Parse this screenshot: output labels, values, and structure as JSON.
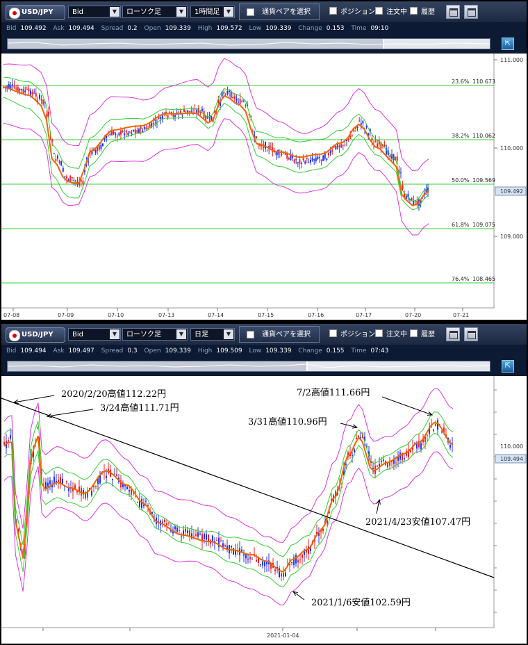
{
  "top_panel": {
    "pair_label": "USD/JPY",
    "price_type": "Bid",
    "chart_type": "ローソク足",
    "timeframe": "1時間足",
    "select_pair_label": "通貨ペアを選択",
    "checkbox_position": "ポジション",
    "checkbox_orders": "注文中",
    "checkbox_history": "履歴",
    "quote": {
      "bid": "109.492",
      "ask": "109.494",
      "spread": "0.2",
      "open": "109.339",
      "high": "109.572",
      "low": "109.339",
      "change": "0.153",
      "time": "09:10"
    },
    "price_labels": [
      "111.000",
      "110.000",
      "109.000"
    ],
    "current_price": "109.492",
    "date_labels": [
      "07-08",
      "07-09",
      "07-10",
      "07-13",
      "07-14",
      "07-15",
      "07-16",
      "07-17",
      "07-20",
      "07-21"
    ],
    "fibonacci": [
      {
        "pct": "23.6%",
        "price": "110.673"
      },
      {
        "pct": "38.2%",
        "price": "110.062"
      },
      {
        "pct": "50.0%",
        "price": "109.569"
      },
      {
        "pct": "61.8%",
        "price": "109.075"
      },
      {
        "pct": "76.4%",
        "price": "108.465"
      }
    ]
  },
  "bottom_panel": {
    "pair_label": "USD/JPY",
    "price_type": "Bid",
    "chart_type": "ローソク足",
    "timeframe": "日足",
    "select_pair_label": "通貨ペアを選択",
    "checkbox_position": "ポジション",
    "checkbox_orders": "注文中",
    "checkbox_history": "履歴",
    "quote": {
      "bid": "109.494",
      "ask": "109.497",
      "spread": "0.3",
      "open": "109.339",
      "high": "109.509",
      "low": "109.339",
      "change": "0.155",
      "time": "07:43"
    },
    "price_labels": [
      "110.000"
    ],
    "current_price": "109.494",
    "date_labels": [
      "2021-01-04"
    ],
    "annotations": {
      "a1": "2020/2/20高値112.22円",
      "a2": "3/24高値111.71円",
      "a3": "7/2高値111.66円",
      "a4": "3/31高値110.96円",
      "a5": "2021/4/23安値107.47円",
      "a6": "2021/1/6安値102.59円"
    }
  },
  "quote_labels": {
    "bid": "Bid",
    "ask": "Ask",
    "spread": "Spread",
    "open": "Open",
    "high": "High",
    "low": "Low",
    "change": "Change",
    "time": "Time"
  },
  "colors": {
    "toolbar": "#27344f",
    "info_bar": "#0c1a33",
    "fibonacci_line": "#33cc33",
    "moving_average": "#ee6600",
    "bollinger_outer": "#dd33dd",
    "bollinger_inner": "#33cc33",
    "bull_candle": "#2233ee",
    "bear_candle": "#ee2222"
  }
}
